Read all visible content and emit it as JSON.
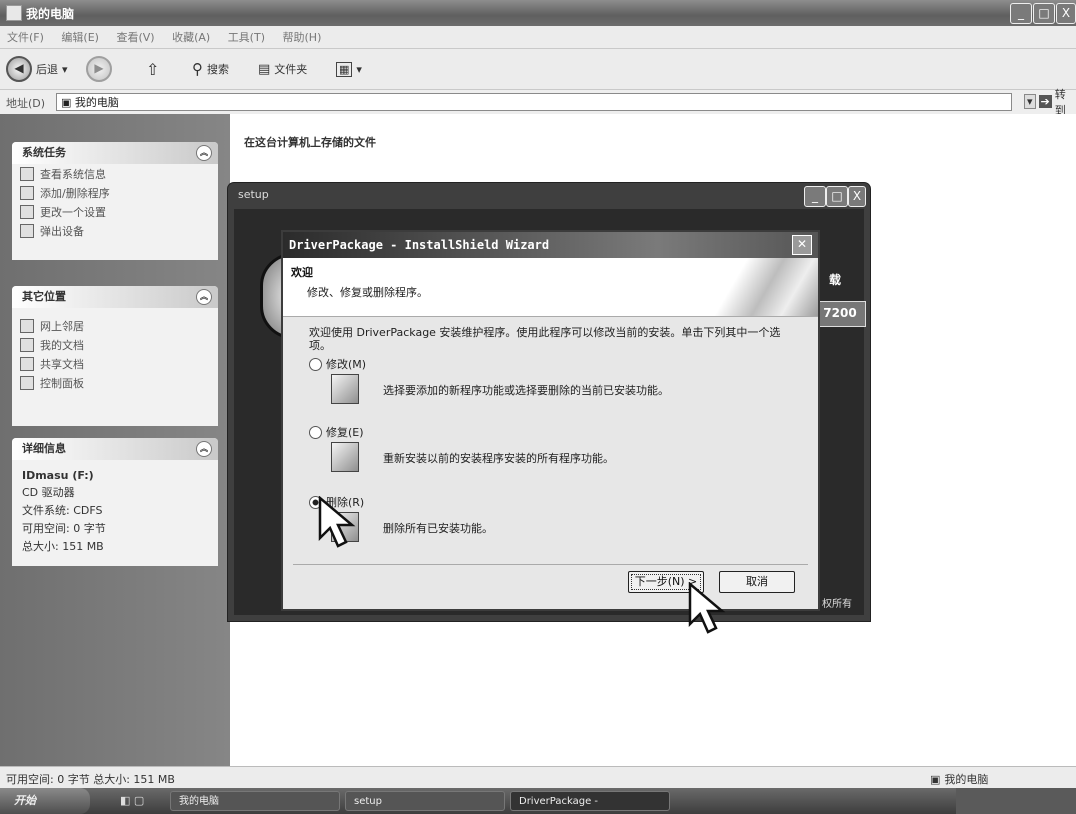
{
  "window": {
    "title": "我的电脑",
    "buttons": [
      "_",
      "□",
      "X"
    ]
  },
  "menu": [
    "文件(F)",
    "编辑(E)",
    "查看(V)",
    "收藏(A)",
    "工具(T)",
    "帮助(H)"
  ],
  "toolbar": {
    "back": "后退",
    "search": "搜索",
    "folders": "文件夹"
  },
  "address": {
    "label": "地址(D)",
    "value": "我的电脑",
    "go": "转到"
  },
  "left_pane": {
    "system_tasks": {
      "title": "系统任务",
      "items": [
        "查看系统信息",
        "添加/删除程序",
        "更改一个设置",
        "弹出设备"
      ]
    },
    "other_places": {
      "title": "其它位置",
      "items": [
        "网上邻居",
        "我的文档",
        "共享文档",
        "控制面板"
      ]
    },
    "details": {
      "title": "详细信息",
      "name": "IDmasu (F:)",
      "type": "CD 驱动器",
      "filesystem": "文件系统: CDFS",
      "free": "可用空间: 0 字节",
      "size": "总大小: 151 MB"
    }
  },
  "main": {
    "heading": "在这台计算机上存储的文件"
  },
  "setup_window": {
    "title": "setup",
    "side_text_1": "载",
    "side_text_2": "7200",
    "rights": "权所有"
  },
  "wizard": {
    "title": "DriverPackage - InstallShield Wizard",
    "header_title": "欢迎",
    "header_subtitle": "修改、修复或删除程序。",
    "intro": "欢迎使用 DriverPackage 安装维护程序。使用此程序可以修改当前的安装。单击下列其中一个选项。",
    "options": [
      {
        "label": "修改(M)",
        "desc": "选择要添加的新程序功能或选择要删除的当前已安装功能。"
      },
      {
        "label": "修复(E)",
        "desc": "重新安装以前的安装程序安装的所有程序功能。"
      },
      {
        "label": "删除(R)",
        "desc": "删除所有已安装功能。"
      }
    ],
    "buttons": {
      "next": "下一步(N) >",
      "cancel": "取消"
    }
  },
  "status": {
    "left": "可用空间: 0 字节  总大小: 151 MB",
    "right": "我的电脑"
  },
  "taskbar": {
    "start": "开始",
    "tasks": [
      "我的电脑",
      "setup",
      "DriverPackage -"
    ]
  }
}
